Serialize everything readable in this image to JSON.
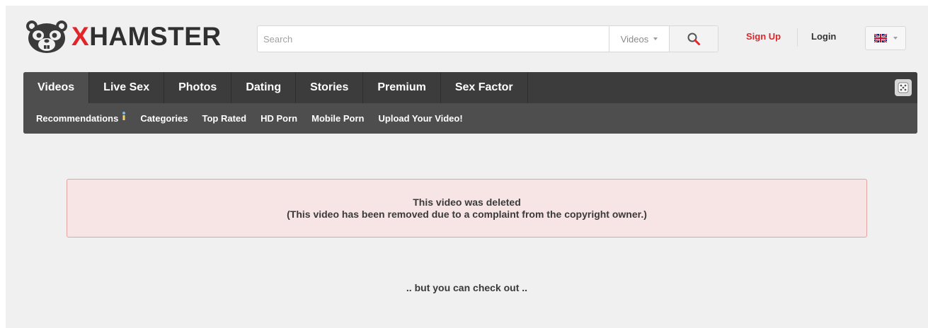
{
  "header": {
    "logo_prefix": "X",
    "logo_rest": "HAMSTER",
    "search": {
      "placeholder": "Search",
      "type_label": "Videos"
    },
    "signup_label": "Sign Up",
    "login_label": "Login",
    "language_icon": "uk-flag-icon"
  },
  "nav": {
    "tabs": [
      {
        "label": "Videos"
      },
      {
        "label": "Live Sex"
      },
      {
        "label": "Photos"
      },
      {
        "label": "Dating"
      },
      {
        "label": "Stories"
      },
      {
        "label": "Premium"
      },
      {
        "label": "Sex Factor"
      }
    ],
    "active_tab": "Videos",
    "subnav": [
      {
        "label": "Recommendations"
      },
      {
        "label": "Categories"
      },
      {
        "label": "Top Rated"
      },
      {
        "label": "HD Porn"
      },
      {
        "label": "Mobile Porn"
      },
      {
        "label": "Upload Your Video!"
      }
    ]
  },
  "main": {
    "alert_line1": "This video was deleted",
    "alert_line2": "(This video has been removed due to a complaint from the copyright owner.)",
    "checkout_text": ".. but you can check out .."
  },
  "colors": {
    "brand_red": "#e0262b",
    "nav_dark": "#3c3c3c",
    "alert_bg": "#f7e4e4",
    "alert_border": "#e3a4a4"
  }
}
